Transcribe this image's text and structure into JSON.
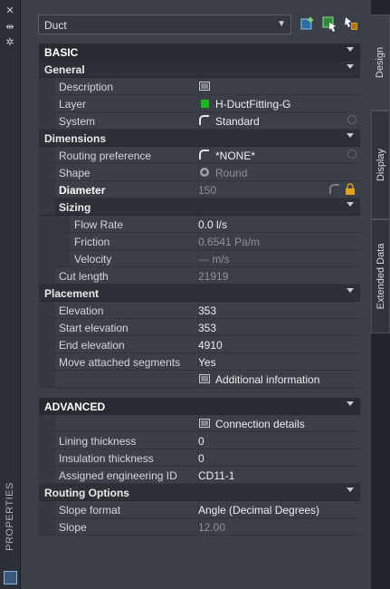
{
  "palette_title": "PROPERTIES",
  "header": {
    "object_type": "Duct"
  },
  "tabs": {
    "design": "Design",
    "display": "Display",
    "extended": "Extended Data"
  },
  "basic": {
    "title": "BASIC",
    "general": {
      "title": "General",
      "description_label": "Description",
      "layer_label": "Layer",
      "layer_value": "H-DuctFitting-G",
      "system_label": "System",
      "system_value": "Standard"
    },
    "dimensions": {
      "title": "Dimensions",
      "routing_label": "Routing preference",
      "routing_value": "*NONE*",
      "shape_label": "Shape",
      "shape_value": "Round",
      "diameter_label": "Diameter",
      "diameter_value": "150",
      "sizing": {
        "title": "Sizing",
        "flow_label": "Flow Rate",
        "flow_value": "0.0 l/s",
        "friction_label": "Friction",
        "friction_value": "0.6541 Pa/m",
        "velocity_label": "Velocity",
        "velocity_value": "--- m/s"
      },
      "cut_length_label": "Cut length",
      "cut_length_value": "21919"
    },
    "placement": {
      "title": "Placement",
      "elevation_label": "Elevation",
      "elevation_value": "353",
      "start_label": "Start elevation",
      "start_value": "353",
      "end_label": "End elevation",
      "end_value": "4910",
      "move_label": "Move attached segments",
      "move_value": "Yes",
      "additional": "Additional information"
    }
  },
  "advanced": {
    "title": "ADVANCED",
    "connection": "Connection details",
    "lining_label": "Lining thickness",
    "lining_value": "0",
    "insulation_label": "Insulation thickness",
    "insulation_value": "0",
    "engid_label": "Assigned engineering ID",
    "engid_value": "CD11-1",
    "routing_options": {
      "title": "Routing Options",
      "slope_format_label": "Slope format",
      "slope_format_value": "Angle (Decimal Degrees)",
      "slope_label": "Slope",
      "slope_value": "12.00"
    }
  }
}
